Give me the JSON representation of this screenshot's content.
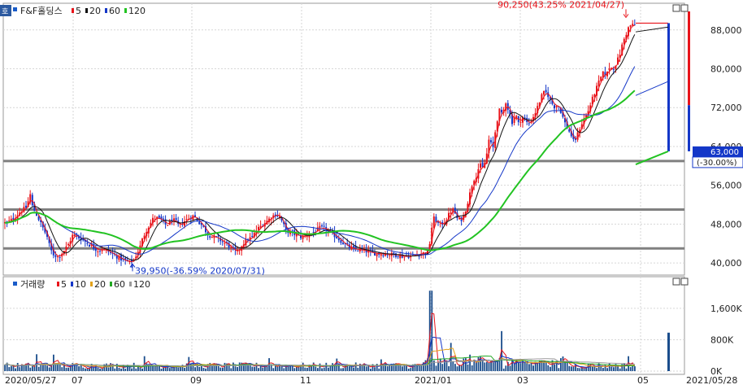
{
  "stock": {
    "name": "F&F홀딩스",
    "ma_legend": [
      {
        "label": "5",
        "color": "#e8131a"
      },
      {
        "label": "20",
        "color": "#111111"
      },
      {
        "label": "60",
        "color": "#1437c8"
      },
      {
        "label": "120",
        "color": "#22c322"
      }
    ],
    "side_button": "호"
  },
  "volume_panel": {
    "title": "거래량",
    "ma_legend": [
      {
        "label": "5",
        "color": "#e8131a"
      },
      {
        "label": "10",
        "color": "#1437c8"
      },
      {
        "label": "20",
        "color": "#e3a21a"
      },
      {
        "label": "60",
        "color": "#22a822"
      },
      {
        "label": "120",
        "color": "#9a9a9a"
      }
    ]
  },
  "annotations": {
    "high": "90,250(43.25% 2021/04/27)",
    "low": "39,950(-36.59% 2020/07/31)",
    "current_price": "63,000",
    "current_change": "(-30.00%)"
  },
  "x_labels": [
    "2020/05/27",
    "07",
    "09",
    "11",
    "2021/01",
    "03",
    "05",
    "2021/05/28"
  ],
  "colors": {
    "up": "#e8131a",
    "down": "#1437c8",
    "grid": "#d6d6d6",
    "hline": "#808080",
    "current_box": "#1437c8"
  },
  "chart_data": [
    {
      "type": "candlestick",
      "title": "F&F홀딩스",
      "y_ticks": [
        40000,
        48000,
        56000,
        64000,
        72000,
        80000,
        88000
      ],
      "y_tick_labels": [
        "40,000",
        "48,000",
        "56,000",
        "64,000",
        "72,000",
        "80,000",
        "88,000"
      ],
      "ylim": [
        37500,
        93500
      ],
      "horizontal_levels": [
        43000,
        51000,
        61000
      ],
      "close_path": [
        [
          0,
          48500
        ],
        [
          8,
          48200
        ],
        [
          18,
          49300
        ],
        [
          26,
          50800
        ],
        [
          34,
          51600
        ],
        [
          36,
          55200
        ],
        [
          40,
          51500
        ],
        [
          46,
          49600
        ],
        [
          52,
          47500
        ],
        [
          58,
          45400
        ],
        [
          62,
          42800
        ],
        [
          66,
          41700
        ],
        [
          72,
          41200
        ],
        [
          78,
          42400
        ],
        [
          84,
          43800
        ],
        [
          90,
          45900
        ],
        [
          96,
          45300
        ],
        [
          102,
          44800
        ],
        [
          108,
          44000
        ],
        [
          114,
          43300
        ],
        [
          120,
          42600
        ],
        [
          126,
          42800
        ],
        [
          132,
          42500
        ],
        [
          138,
          41900
        ],
        [
          144,
          41300
        ],
        [
          150,
          40700
        ],
        [
          156,
          40300
        ],
        [
          160,
          40150
        ],
        [
          164,
          40500
        ],
        [
          168,
          41800
        ],
        [
          172,
          43200
        ],
        [
          176,
          45300
        ],
        [
          180,
          46700
        ],
        [
          184,
          47900
        ],
        [
          188,
          49000
        ],
        [
          192,
          49400
        ],
        [
          196,
          49000
        ],
        [
          200,
          48800
        ],
        [
          204,
          47800
        ],
        [
          208,
          48200
        ],
        [
          212,
          49000
        ],
        [
          216,
          48500
        ],
        [
          220,
          47600
        ],
        [
          226,
          48500
        ],
        [
          232,
          49200
        ],
        [
          238,
          49700
        ],
        [
          244,
          48600
        ],
        [
          250,
          47400
        ],
        [
          256,
          45800
        ],
        [
          262,
          45400
        ],
        [
          268,
          45100
        ],
        [
          274,
          44300
        ],
        [
          280,
          43800
        ],
        [
          286,
          42700
        ],
        [
          292,
          42300
        ],
        [
          298,
          43800
        ],
        [
          304,
          44800
        ],
        [
          310,
          45300
        ],
        [
          316,
          46800
        ],
        [
          322,
          47800
        ],
        [
          328,
          48600
        ],
        [
          334,
          49500
        ],
        [
          340,
          50100
        ],
        [
          344,
          49500
        ],
        [
          348,
          48200
        ],
        [
          352,
          46600
        ],
        [
          358,
          46300
        ],
        [
          364,
          45800
        ],
        [
          370,
          45400
        ],
        [
          376,
          45600
        ],
        [
          382,
          46000
        ],
        [
          388,
          46500
        ],
        [
          394,
          47300
        ],
        [
          400,
          47000
        ],
        [
          406,
          46300
        ],
        [
          412,
          45600
        ],
        [
          418,
          44700
        ],
        [
          424,
          43800
        ],
        [
          430,
          43200
        ],
        [
          436,
          42800
        ],
        [
          442,
          42700
        ],
        [
          448,
          42600
        ],
        [
          454,
          42200
        ],
        [
          460,
          42000
        ],
        [
          466,
          41900
        ],
        [
          472,
          41800
        ],
        [
          478,
          41800
        ],
        [
          484,
          41700
        ],
        [
          490,
          41600
        ],
        [
          496,
          41300
        ],
        [
          502,
          41400
        ],
        [
          508,
          41500
        ],
        [
          514,
          41800
        ],
        [
          520,
          42000
        ],
        [
          526,
          42300
        ],
        [
          528,
          43000
        ],
        [
          530,
          46500
        ],
        [
          534,
          49300
        ],
        [
          538,
          48200
        ],
        [
          542,
          47900
        ],
        [
          546,
          48300
        ],
        [
          550,
          49200
        ],
        [
          554,
          50600
        ],
        [
          558,
          51000
        ],
        [
          562,
          49200
        ],
        [
          566,
          48700
        ],
        [
          570,
          49500
        ],
        [
          574,
          51600
        ],
        [
          578,
          54300
        ],
        [
          582,
          57000
        ],
        [
          586,
          58000
        ],
        [
          590,
          60300
        ],
        [
          594,
          59400
        ],
        [
          598,
          61600
        ],
        [
          602,
          66000
        ],
        [
          606,
          63000
        ],
        [
          610,
          68000
        ],
        [
          614,
          71500
        ],
        [
          618,
          70300
        ],
        [
          622,
          73300
        ],
        [
          626,
          71200
        ],
        [
          630,
          69000
        ],
        [
          634,
          70800
        ],
        [
          638,
          68600
        ],
        [
          642,
          70100
        ],
        [
          646,
          69500
        ],
        [
          650,
          68400
        ],
        [
          654,
          69500
        ],
        [
          658,
          70800
        ],
        [
          662,
          72400
        ],
        [
          666,
          74300
        ],
        [
          670,
          75300
        ],
        [
          674,
          74600
        ],
        [
          678,
          73100
        ],
        [
          682,
          72200
        ],
        [
          686,
          72600
        ],
        [
          690,
          71200
        ],
        [
          694,
          69200
        ],
        [
          698,
          67700
        ],
        [
          702,
          66600
        ],
        [
          706,
          64800
        ],
        [
          710,
          66300
        ],
        [
          714,
          68100
        ],
        [
          718,
          69600
        ],
        [
          722,
          70600
        ],
        [
          726,
          72500
        ],
        [
          730,
          74400
        ],
        [
          734,
          76100
        ],
        [
          738,
          77800
        ],
        [
          742,
          79100
        ],
        [
          746,
          78700
        ],
        [
          750,
          80500
        ],
        [
          754,
          79900
        ],
        [
          758,
          81200
        ],
        [
          762,
          82700
        ],
        [
          766,
          85300
        ],
        [
          770,
          87100
        ],
        [
          773,
          88400
        ],
        [
          776,
          89000
        ],
        [
          779,
          89000
        ],
        [
          782,
          89000
        ],
        [
          822,
          89000
        ],
        [
          826,
          63000
        ]
      ],
      "high": {
        "value": 90250,
        "date": "2021/04/27"
      },
      "low": {
        "value": 39950,
        "date": "2020/07/31"
      },
      "last": {
        "value": 63000,
        "change_pct": -30.0
      }
    },
    {
      "type": "bar",
      "title": "거래량",
      "y_ticks": [
        0,
        800000,
        1600000
      ],
      "y_tick_labels": [
        "0K",
        "800K",
        "1,600K"
      ],
      "ylim": [
        0,
        2200000
      ],
      "spikes": [
        {
          "x": 530,
          "value": 2050000
        },
        {
          "x": 822,
          "value": 980000
        },
        {
          "x": 616,
          "value": 1020000
        },
        {
          "x": 554,
          "value": 720000
        },
        {
          "x": 578,
          "value": 420000
        },
        {
          "x": 44,
          "value": 430000
        },
        {
          "x": 66,
          "value": 420000
        },
        {
          "x": 178,
          "value": 380000
        },
        {
          "x": 232,
          "value": 360000
        },
        {
          "x": 330,
          "value": 330000
        },
        {
          "x": 414,
          "value": 320000
        },
        {
          "x": 470,
          "value": 300000
        },
        {
          "x": 690,
          "value": 330000
        },
        {
          "x": 772,
          "value": 380000
        }
      ]
    }
  ]
}
